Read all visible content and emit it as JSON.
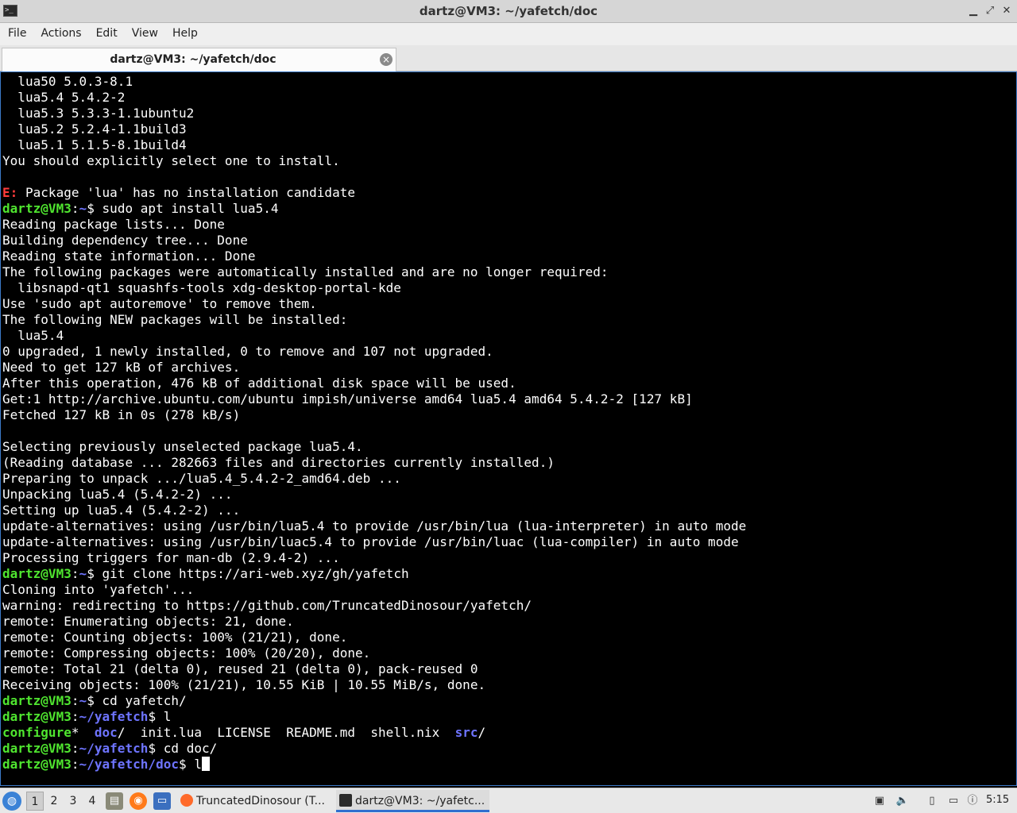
{
  "window": {
    "title": "dartz@VM3: ~/yafetch/doc",
    "minimize": "▁",
    "maximize": "⤢",
    "close": "✕"
  },
  "menu": [
    "File",
    "Actions",
    "Edit",
    "View",
    "Help"
  ],
  "tab": {
    "label": "dartz@VM3: ~/yafetch/doc",
    "close": "×"
  },
  "terminal": {
    "lines": [
      [
        {
          "t": "  lua50 5.0.3-8.1"
        }
      ],
      [
        {
          "t": "  lua5.4 5.4.2-2"
        }
      ],
      [
        {
          "t": "  lua5.3 5.3.3-1.1ubuntu2"
        }
      ],
      [
        {
          "t": "  lua5.2 5.2.4-1.1build3"
        }
      ],
      [
        {
          "t": "  lua5.1 5.1.5-8.1build4"
        }
      ],
      [
        {
          "t": "You should explicitly select one to install."
        }
      ],
      [
        {
          "t": ""
        }
      ],
      [
        {
          "t": "E:",
          "c": "err"
        },
        {
          "t": " Package 'lua' has no installation candidate"
        }
      ],
      [
        {
          "t": "dartz@VM3",
          "c": "user"
        },
        {
          "t": ":"
        },
        {
          "t": "~",
          "c": "path"
        },
        {
          "t": "$ sudo apt install lua5.4"
        }
      ],
      [
        {
          "t": "Reading package lists... Done"
        }
      ],
      [
        {
          "t": "Building dependency tree... Done"
        }
      ],
      [
        {
          "t": "Reading state information... Done"
        }
      ],
      [
        {
          "t": "The following packages were automatically installed and are no longer required:"
        }
      ],
      [
        {
          "t": "  libsnapd-qt1 squashfs-tools xdg-desktop-portal-kde"
        }
      ],
      [
        {
          "t": "Use 'sudo apt autoremove' to remove them."
        }
      ],
      [
        {
          "t": "The following NEW packages will be installed:"
        }
      ],
      [
        {
          "t": "  lua5.4"
        }
      ],
      [
        {
          "t": "0 upgraded, 1 newly installed, 0 to remove and 107 not upgraded."
        }
      ],
      [
        {
          "t": "Need to get 127 kB of archives."
        }
      ],
      [
        {
          "t": "After this operation, 476 kB of additional disk space will be used."
        }
      ],
      [
        {
          "t": "Get:1 http://archive.ubuntu.com/ubuntu impish/universe amd64 lua5.4 amd64 5.4.2-2 [127 kB]"
        }
      ],
      [
        {
          "t": "Fetched 127 kB in 0s (278 kB/s)"
        }
      ],
      [
        {
          "t": ""
        }
      ],
      [
        {
          "t": "Selecting previously unselected package lua5.4."
        }
      ],
      [
        {
          "t": "(Reading database ... 282663 files and directories currently installed.)"
        }
      ],
      [
        {
          "t": "Preparing to unpack .../lua5.4_5.4.2-2_amd64.deb ..."
        }
      ],
      [
        {
          "t": "Unpacking lua5.4 (5.4.2-2) ..."
        }
      ],
      [
        {
          "t": "Setting up lua5.4 (5.4.2-2) ..."
        }
      ],
      [
        {
          "t": "update-alternatives: using /usr/bin/lua5.4 to provide /usr/bin/lua (lua-interpreter) in auto mode"
        }
      ],
      [
        {
          "t": "update-alternatives: using /usr/bin/luac5.4 to provide /usr/bin/luac (lua-compiler) in auto mode"
        }
      ],
      [
        {
          "t": "Processing triggers for man-db (2.9.4-2) ..."
        }
      ],
      [
        {
          "t": "dartz@VM3",
          "c": "user"
        },
        {
          "t": ":"
        },
        {
          "t": "~",
          "c": "path"
        },
        {
          "t": "$ git clone https://ari-web.xyz/gh/yafetch"
        }
      ],
      [
        {
          "t": "Cloning into 'yafetch'..."
        }
      ],
      [
        {
          "t": "warning: redirecting to https://github.com/TruncatedDinosour/yafetch/"
        }
      ],
      [
        {
          "t": "remote: Enumerating objects: 21, done."
        }
      ],
      [
        {
          "t": "remote: Counting objects: 100% (21/21), done."
        }
      ],
      [
        {
          "t": "remote: Compressing objects: 100% (20/20), done."
        }
      ],
      [
        {
          "t": "remote: Total 21 (delta 0), reused 21 (delta 0), pack-reused 0"
        }
      ],
      [
        {
          "t": "Receiving objects: 100% (21/21), 10.55 KiB | 10.55 MiB/s, done."
        }
      ],
      [
        {
          "t": "dartz@VM3",
          "c": "user"
        },
        {
          "t": ":"
        },
        {
          "t": "~",
          "c": "path"
        },
        {
          "t": "$ cd yafetch/"
        }
      ],
      [
        {
          "t": "dartz@VM3",
          "c": "user"
        },
        {
          "t": ":"
        },
        {
          "t": "~/yafetch",
          "c": "path"
        },
        {
          "t": "$ l"
        }
      ],
      [
        {
          "t": "configure",
          "c": "exec"
        },
        {
          "t": "*  "
        },
        {
          "t": "doc",
          "c": "dir"
        },
        {
          "t": "/  init.lua  LICENSE  README.md  shell.nix  "
        },
        {
          "t": "src",
          "c": "dir"
        },
        {
          "t": "/"
        }
      ],
      [
        {
          "t": "dartz@VM3",
          "c": "user"
        },
        {
          "t": ":"
        },
        {
          "t": "~/yafetch",
          "c": "path"
        },
        {
          "t": "$ cd doc/"
        }
      ],
      [
        {
          "t": "dartz@VM3",
          "c": "user"
        },
        {
          "t": ":"
        },
        {
          "t": "~/yafetch/doc",
          "c": "path"
        },
        {
          "t": "$ l"
        },
        {
          "cursor": true
        }
      ]
    ]
  },
  "taskbar": {
    "start_icon": "start-menu-icon",
    "workspaces": [
      "1",
      "2",
      "3",
      "4"
    ],
    "active_workspace": 0,
    "tasks": [
      {
        "label": "TruncatedDinosour (T...",
        "icon": "firefox-icon"
      },
      {
        "label": "dartz@VM3: ~/yafetc...",
        "icon": "terminal-icon"
      }
    ],
    "clock": "5:15"
  },
  "colors": {
    "prompt_user": "#4fe52f",
    "prompt_path": "#6e74ff",
    "error": "#ff3b3b",
    "terminal_bg": "#000000",
    "terminal_fg": "#ffffff"
  }
}
